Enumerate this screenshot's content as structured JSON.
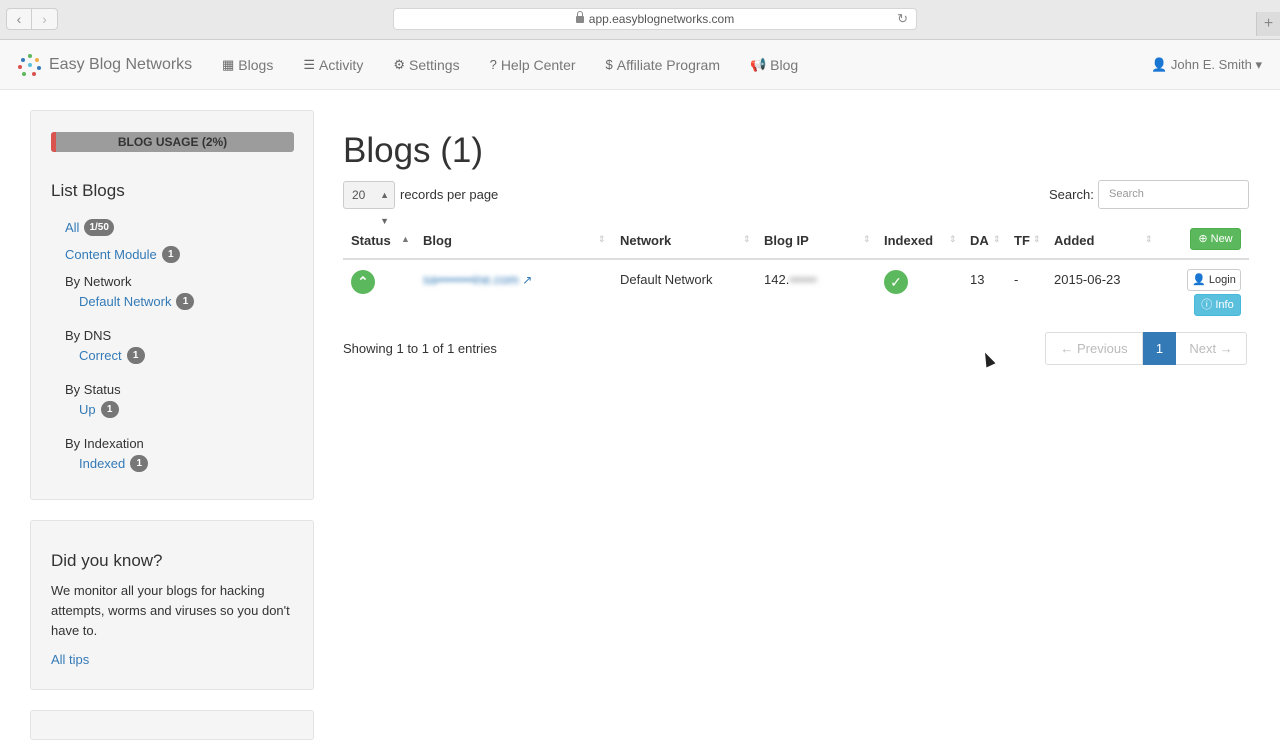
{
  "browser": {
    "url": "app.easyblognetworks.com",
    "back_glyph": "‹",
    "forward_glyph": "›",
    "reload_glyph": "↻",
    "new_tab_glyph": "+"
  },
  "navbar": {
    "brand": "Easy Blog Networks",
    "items": [
      {
        "label": "Blogs",
        "icon": "grid-icon",
        "glyph": "▦"
      },
      {
        "label": "Activity",
        "icon": "rss-icon",
        "glyph": "☰"
      },
      {
        "label": "Settings",
        "icon": "gear-icon",
        "glyph": "⚙"
      },
      {
        "label": "Help Center",
        "icon": "question-icon",
        "glyph": "?"
      },
      {
        "label": "Affiliate Program",
        "icon": "dollar-icon",
        "glyph": "$"
      },
      {
        "label": "Blog",
        "icon": "bullhorn-icon",
        "glyph": "📢"
      }
    ],
    "user": "John E. Smith",
    "user_glyph": "👤",
    "caret": "▾"
  },
  "sidebar": {
    "usage_label": "BLOG USAGE (2%)",
    "usage_percent": 2,
    "usage_color": "#d9534f",
    "title": "List Blogs",
    "all": {
      "label": "All",
      "count": "1/50"
    },
    "content_module": {
      "label": "Content Module",
      "count": "1"
    },
    "by_network": {
      "label": "By Network",
      "item": "Default Network",
      "count": "1"
    },
    "by_dns": {
      "label": "By DNS",
      "item": "Correct",
      "count": "1"
    },
    "by_status": {
      "label": "By Status",
      "item": "Up",
      "count": "1"
    },
    "by_indexation": {
      "label": "By Indexation",
      "item": "Indexed",
      "count": "1"
    }
  },
  "tip": {
    "title": "Did you know?",
    "text": "We monitor all your blogs for hacking attempts, worms and viruses so you don't have to.",
    "link": "All tips"
  },
  "main": {
    "title": "Blogs (1)",
    "page_length": "20",
    "length_label": "records per page",
    "search_label": "Search:",
    "search_placeholder": "Search",
    "columns": [
      "Status",
      "Blog",
      "Network",
      "Blog IP",
      "Indexed",
      "DA",
      "TF",
      "Added"
    ],
    "new_button": "New",
    "rows": [
      {
        "status": "up",
        "blog": "sa••••••••ine.com",
        "network": "Default Network",
        "ip_prefix": "142.",
        "ip_hidden": "••••••",
        "indexed": true,
        "da": "13",
        "tf": "-",
        "added": "2015-06-23",
        "login_label": "Login",
        "info_label": "Info"
      }
    ],
    "info": "Showing 1 to 1 of 1 entries",
    "pagination": {
      "prev": "← Previous",
      "current": "1",
      "next": "Next →"
    }
  },
  "colors": {
    "success": "#5cb85c",
    "info": "#5bc0de",
    "primary": "#337ab7"
  }
}
